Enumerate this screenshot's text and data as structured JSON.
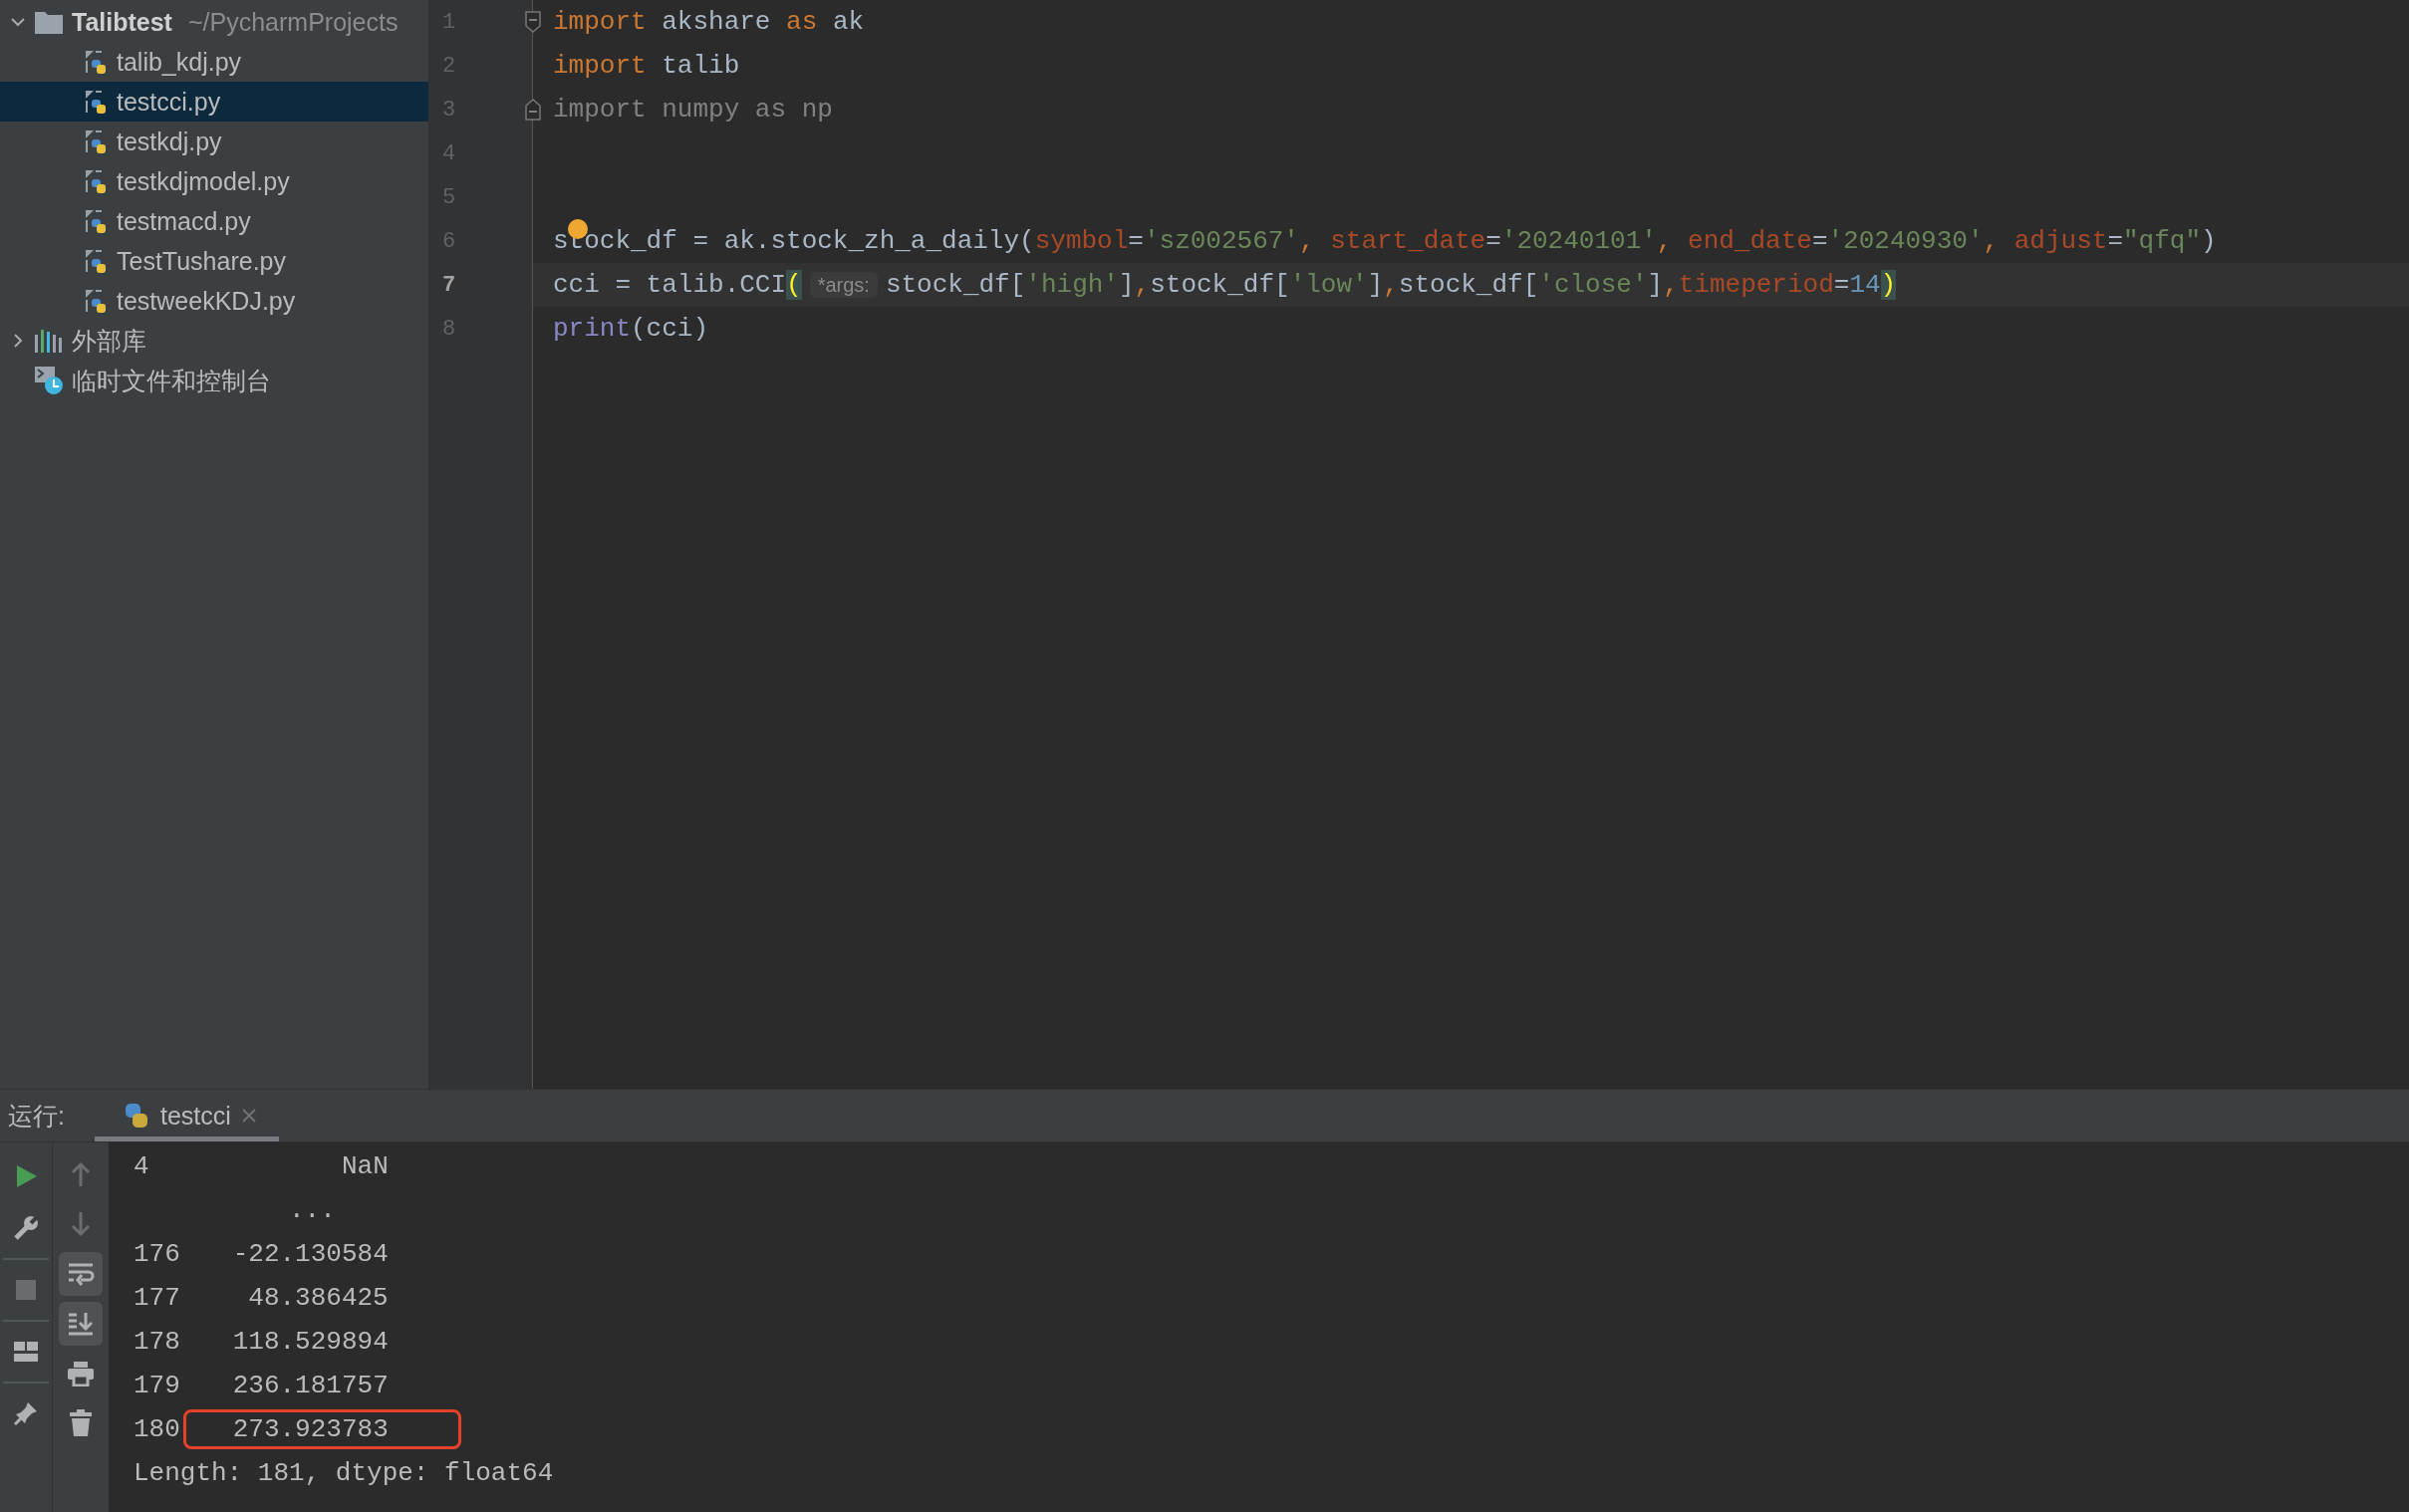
{
  "sidebar": {
    "items": [
      {
        "kind": "folder",
        "name": "Talibtest",
        "path": "~/PycharmProjects",
        "expanded": true,
        "selected": false,
        "children": [
          {
            "kind": "python",
            "name": "talib_kdj.py",
            "selected": false
          },
          {
            "kind": "python",
            "name": "testcci.py",
            "selected": true
          },
          {
            "kind": "python",
            "name": "testkdj.py",
            "selected": false
          },
          {
            "kind": "python",
            "name": "testkdjmodel.py",
            "selected": false
          },
          {
            "kind": "python",
            "name": "testmacd.py",
            "selected": false
          },
          {
            "kind": "python",
            "name": "TestTushare.py",
            "selected": false
          },
          {
            "kind": "python",
            "name": "testweekKDJ.py",
            "selected": false
          }
        ]
      },
      {
        "kind": "library",
        "name": "外部库",
        "expanded": false,
        "selected": false
      },
      {
        "kind": "scratches",
        "name": "临时文件和控制台",
        "selected": false
      }
    ]
  },
  "editor": {
    "lines": [
      {
        "number": "1",
        "current": false,
        "fold_start": true,
        "tokens": [
          {
            "kind": "keyword",
            "text": "import"
          },
          {
            "kind": "ident",
            "text": " akshare "
          },
          {
            "kind": "keyword",
            "text": "as"
          },
          {
            "kind": "ident",
            "text": " ak"
          }
        ]
      },
      {
        "number": "2",
        "current": false,
        "tokens": [
          {
            "kind": "keyword",
            "text": "import"
          },
          {
            "kind": "ident",
            "text": " talib"
          }
        ]
      },
      {
        "number": "3",
        "current": false,
        "fold_end": true,
        "tokens": [
          {
            "kind": "unused",
            "text": "import numpy as np"
          }
        ]
      },
      {
        "number": "4",
        "current": false
      },
      {
        "number": "5",
        "current": false
      },
      {
        "number": "6",
        "current": false,
        "bulb": true,
        "tokens": [
          {
            "kind": "ident",
            "text": "stock_df = ak.stock_zh_a_daily("
          },
          {
            "kind": "param",
            "text": "symbol"
          },
          {
            "kind": "ident",
            "text": "="
          },
          {
            "kind": "string",
            "text": "'sz002567'"
          },
          {
            "kind": "punct",
            "text": ", "
          },
          {
            "kind": "param",
            "text": "start_date"
          },
          {
            "kind": "ident",
            "text": "="
          },
          {
            "kind": "string",
            "text": "'20240101'"
          },
          {
            "kind": "punct",
            "text": ", "
          },
          {
            "kind": "param",
            "text": "end_date"
          },
          {
            "kind": "ident",
            "text": "="
          },
          {
            "kind": "string",
            "text": "'20240930'"
          },
          {
            "kind": "punct",
            "text": ", "
          },
          {
            "kind": "param",
            "text": "adjust"
          },
          {
            "kind": "ident",
            "text": "="
          },
          {
            "kind": "string",
            "text": "\"qfq\""
          },
          {
            "kind": "ident",
            "text": ")"
          }
        ]
      },
      {
        "number": "7",
        "current": true,
        "tokens": [
          {
            "kind": "ident",
            "text": "cci = talib.CCI"
          },
          {
            "kind": "brace",
            "text": "("
          },
          {
            "kind": "hint",
            "text": "*args:"
          },
          {
            "kind": "ident",
            "text": "stock_df["
          },
          {
            "kind": "string",
            "text": "'high'"
          },
          {
            "kind": "ident",
            "text": "]"
          },
          {
            "kind": "punct",
            "text": ","
          },
          {
            "kind": "ident",
            "text": "stock_df["
          },
          {
            "kind": "string",
            "text": "'low'"
          },
          {
            "kind": "ident",
            "text": "]"
          },
          {
            "kind": "punct",
            "text": ","
          },
          {
            "kind": "ident",
            "text": "stock_df["
          },
          {
            "kind": "string",
            "text": "'close'"
          },
          {
            "kind": "ident",
            "text": "]"
          },
          {
            "kind": "punct",
            "text": ","
          },
          {
            "kind": "param",
            "text": "timeperiod"
          },
          {
            "kind": "ident",
            "text": "="
          },
          {
            "kind": "number",
            "text": "14"
          },
          {
            "kind": "brace",
            "text": ")"
          }
        ]
      },
      {
        "number": "8",
        "current": false,
        "tokens": [
          {
            "kind": "builtin",
            "text": "print"
          },
          {
            "kind": "ident",
            "text": "(cci)"
          }
        ]
      }
    ]
  },
  "run_panel": {
    "label": "运行:",
    "tabs": [
      {
        "label": "testcci",
        "selected": true
      }
    ],
    "left_toolbar": [
      {
        "kind": "run",
        "disabled": false
      },
      {
        "kind": "wrench",
        "disabled": false
      },
      {
        "kind": "stop",
        "disabled": true
      },
      {
        "kind": "layout",
        "disabled": false
      },
      {
        "kind": "pin",
        "disabled": false
      }
    ],
    "right_toolbar": [
      {
        "kind": "up",
        "disabled": true,
        "on": false
      },
      {
        "kind": "down",
        "disabled": true,
        "on": false
      },
      {
        "kind": "wrap",
        "disabled": false,
        "on": true
      },
      {
        "kind": "scroll-end",
        "disabled": false,
        "on": true
      },
      {
        "kind": "print",
        "disabled": false,
        "on": false
      },
      {
        "kind": "trash",
        "disabled": false,
        "on": false
      }
    ],
    "console": {
      "lines": [
        {
          "kind": "row",
          "index": "4",
          "value": "NaN",
          "highlighted": false
        },
        {
          "kind": "dots",
          "text": "..."
        },
        {
          "kind": "row",
          "index": "176",
          "value": "-22.130584",
          "highlighted": false
        },
        {
          "kind": "row",
          "index": "177",
          "value": "48.386425",
          "highlighted": false
        },
        {
          "kind": "row",
          "index": "178",
          "value": "118.529894",
          "highlighted": false
        },
        {
          "kind": "row",
          "index": "179",
          "value": "236.181757",
          "highlighted": false
        },
        {
          "kind": "row",
          "index": "180",
          "value": "273.923783",
          "highlighted": true
        },
        {
          "kind": "text",
          "text": "Length: 181, dtype: float64"
        }
      ]
    }
  }
}
